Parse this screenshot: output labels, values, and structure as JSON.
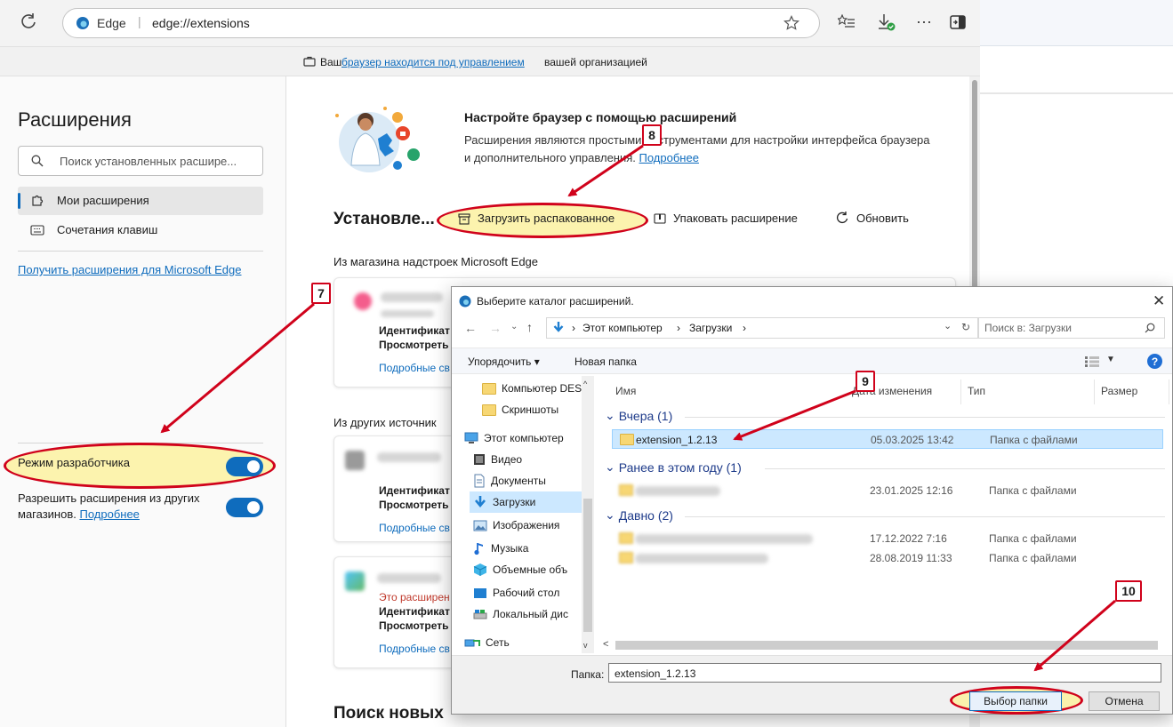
{
  "browser": {
    "tab_name": "Edge",
    "url": "edge://extensions",
    "managed_prefix": "Ваш",
    "managed_link": "браузер находится под управлением",
    "managed_suffix": "вашей организацией"
  },
  "sidebar": {
    "title": "Расширения",
    "search_placeholder": "Поиск установленных расшире...",
    "items": [
      {
        "label": "Мои расширения"
      },
      {
        "label": "Сочетания клавиш"
      }
    ],
    "get_link": "Получить расширения для Microsoft Edge",
    "dev_mode_label": "Режим разработчика",
    "allow_other_label": "Разрешить расширения из других магазинов.",
    "allow_other_link": "Подробнее"
  },
  "main": {
    "promo_title": "Настройте браузер с помощью расширений",
    "promo_text": "Расширения являются простыми инструментами для настройки интерфейса браузера и дополнительного управления.",
    "promo_link": "Подробнее",
    "installed_title": "Установле...",
    "load_unpacked": "Загрузить распакованное",
    "pack": "Упаковать расширение",
    "update": "Обновить",
    "from_store": "Из магазина надстроек Microsoft Edge",
    "from_other": "Из других источник",
    "find_new": "Поиск новых",
    "card_id": "Идентификат",
    "card_view": "Просмотреть",
    "card_details": "Подробные св",
    "card_note": "Это расширен"
  },
  "dialog": {
    "title": "Выберите каталог расширений.",
    "breadcrumb": [
      "Этот компьютер",
      "Загрузки"
    ],
    "search_placeholder": "Поиск в: Загрузки",
    "organize": "Упорядочить ▾",
    "new_folder": "Новая папка",
    "nav_items": [
      "Компьютер DES",
      "Скриншоты",
      "Этот компьютер",
      "Видео",
      "Документы",
      "Загрузки",
      "Изображения",
      "Музыка",
      "Объемные объ",
      "Рабочий стол",
      "Локальный дис",
      "Сеть"
    ],
    "columns": [
      "Имя",
      "Дата изменения",
      "Тип",
      "Размер"
    ],
    "groups": [
      {
        "label": "Вчера (1)",
        "rows": [
          {
            "name": "extension_1.2.13",
            "date": "05.03.2025 13:42",
            "type": "Папка с файлами"
          }
        ]
      },
      {
        "label": "Ранее в этом году (1)",
        "rows": [
          {
            "name": "",
            "date": "23.01.2025 12:16",
            "type": "Папка с файлами"
          }
        ]
      },
      {
        "label": "Давно (2)",
        "rows": [
          {
            "name": "",
            "date": "17.12.2022 7:16",
            "type": "Папка с файлами"
          },
          {
            "name": "",
            "date": "28.08.2019 11:33",
            "type": "Папка с файлами"
          }
        ]
      }
    ],
    "folder_label": "Папка:",
    "folder_value": "extension_1.2.13",
    "select_button": "Выбор папки",
    "cancel_button": "Отмена"
  },
  "annotations": {
    "badges": [
      "7",
      "8",
      "9",
      "10"
    ],
    "color": "#d0021b"
  },
  "colors": {
    "accent": "#0f6cbd",
    "highlight": "#fbf1a0"
  }
}
